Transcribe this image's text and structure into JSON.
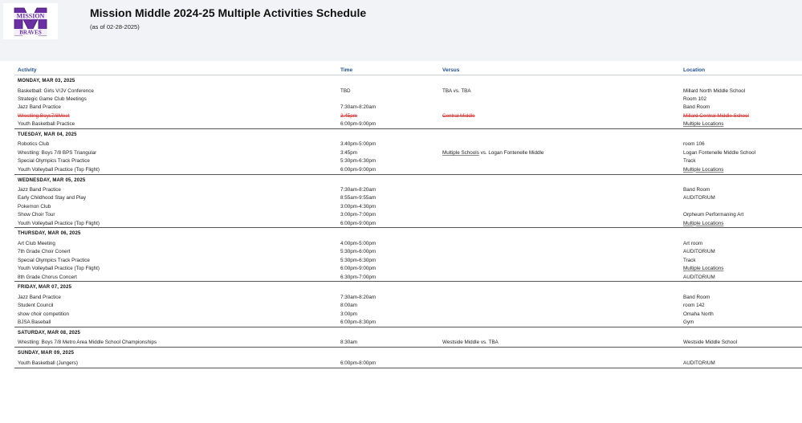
{
  "header": {
    "logo": {
      "line1": "MISSION",
      "line2": "BRAVES",
      "mark": "M"
    },
    "title": "Mission Middle 2024-25 Multiple Activities Schedule",
    "as_of": "(as of 02-28-2025)"
  },
  "columns": [
    "Activity",
    "Time",
    "Versus",
    "Location"
  ],
  "days": [
    {
      "date": "MONDAY, MAR 03, 2025",
      "rows": [
        {
          "activity": "Basketball: Girls V/JV Conference",
          "time": "TBD",
          "versus": "TBA vs. TBA",
          "location": "Millard North Middle School"
        },
        {
          "activity": "Strategic Game Club Meetings",
          "time": "",
          "versus": "",
          "location": "Room 102"
        },
        {
          "activity": "Jazz Band Practice",
          "time": "7:30am-8:20am",
          "versus": "",
          "location": "Band Room"
        },
        {
          "activity": "Wrestling:Boys7/8Meet",
          "time": "3:45pm",
          "versus": "Central Middle",
          "location": "Millard Central Middle School",
          "cancelled": true
        },
        {
          "activity": "Youth Basketball Practice",
          "time": "6:00pm-9:00pm",
          "versus": "",
          "location": "Multiple Locations",
          "location_link": true
        }
      ]
    },
    {
      "date": "TUESDAY, MAR 04, 2025",
      "rows": [
        {
          "activity": "Robotics Club",
          "time": "3:40pm-5:00pm",
          "versus": "",
          "location": "room 106"
        },
        {
          "activity": "Wrestling: Boys 7/8 BPS Triangular",
          "time": "3:45pm",
          "versus_link": "Multiple Schools",
          "versus": " vs. Logan Fontenelle Middle",
          "location": "Logan Fontenelle Middle School"
        },
        {
          "activity": "Special Olympics Track Practice",
          "time": "5:30pm-6:30pm",
          "versus": "",
          "location": "Track"
        },
        {
          "activity": "Youth Volleyball Practice (Top Flight)",
          "time": "6:00pm-9:00pm",
          "versus": "",
          "location": "Multiple Locations",
          "location_link": true
        }
      ]
    },
    {
      "date": "WEDNESDAY, MAR 05, 2025",
      "rows": [
        {
          "activity": "Jazz Band Practice",
          "time": "7:30am-8:20am",
          "versus": "",
          "location": "Band Room"
        },
        {
          "activity": "Early Childhood Stay and Play",
          "time": "8:55am-9:55am",
          "versus": "",
          "location": "AUDITORIUM"
        },
        {
          "activity": "Pokemon Club",
          "time": "3:00pm-4:30pm",
          "versus": "",
          "location": ""
        },
        {
          "activity": "Show Choir Tour",
          "time": "3:00pm-7:00pm",
          "versus": "",
          "location": "Orpheum Performaning Art"
        },
        {
          "activity": "Youth Volleyball Practice (Top Flight)",
          "time": "6:00pm-9:00pm",
          "versus": "",
          "location": "Multiple Locations",
          "location_link": true
        }
      ]
    },
    {
      "date": "THURSDAY, MAR 06, 2025",
      "rows": [
        {
          "activity": "Art Club Meeting",
          "time": "4:00pm-5:00pm",
          "versus": "",
          "location": "Art room"
        },
        {
          "activity": "7th Grade Choir Conert",
          "time": "5:30pm-6:00pm",
          "versus": "",
          "location": "AUDITORIUM"
        },
        {
          "activity": "Special Olympics Track Practice",
          "time": "5:30pm-6:30pm",
          "versus": "",
          "location": "Track"
        },
        {
          "activity": "Youth Volleyball Practice (Top Flight)",
          "time": "6:00pm-9:00pm",
          "versus": "",
          "location": "Multiple Locations",
          "location_link": true
        },
        {
          "activity": "8th Grade Chorus Concert",
          "time": "6:30pm-7:00pm",
          "versus": "",
          "location": "AUDITORIUM"
        }
      ]
    },
    {
      "date": "FRIDAY, MAR 07, 2025",
      "rows": [
        {
          "activity": "Jazz Band Practice",
          "time": "7:30am-8:20am",
          "versus": "",
          "location": "Band Room"
        },
        {
          "activity": "Student Council",
          "time": "8:00am",
          "versus": "",
          "location": "room 142"
        },
        {
          "activity": "show choir competition",
          "time": "3:00pm",
          "versus": "",
          "location": "Omaha North"
        },
        {
          "activity": "BJSA Baseball",
          "time": "6:00pm-8:30pm",
          "versus": "",
          "location": "Gym"
        }
      ]
    },
    {
      "date": "SATURDAY, MAR 08, 2025",
      "rows": [
        {
          "activity": "Wrestling: Boys 7/8 Metro Area Middle School Championships",
          "time": "8:30am",
          "versus": "Westside Middle vs. TBA",
          "location": "Westside Middle School"
        }
      ]
    },
    {
      "date": "SUNDAY, MAR 09, 2025",
      "rows": [
        {
          "activity": "Youth Basketball (Jungers)",
          "time": "6:00pm-8:00pm",
          "versus": "",
          "location": "AUDITORIUM"
        }
      ]
    }
  ],
  "colors": {
    "header_bg": "#f2f3f6",
    "column_header": "#1d4f8c",
    "cancelled": "#d42a2a",
    "logo_purple": "#6a2fa0"
  }
}
